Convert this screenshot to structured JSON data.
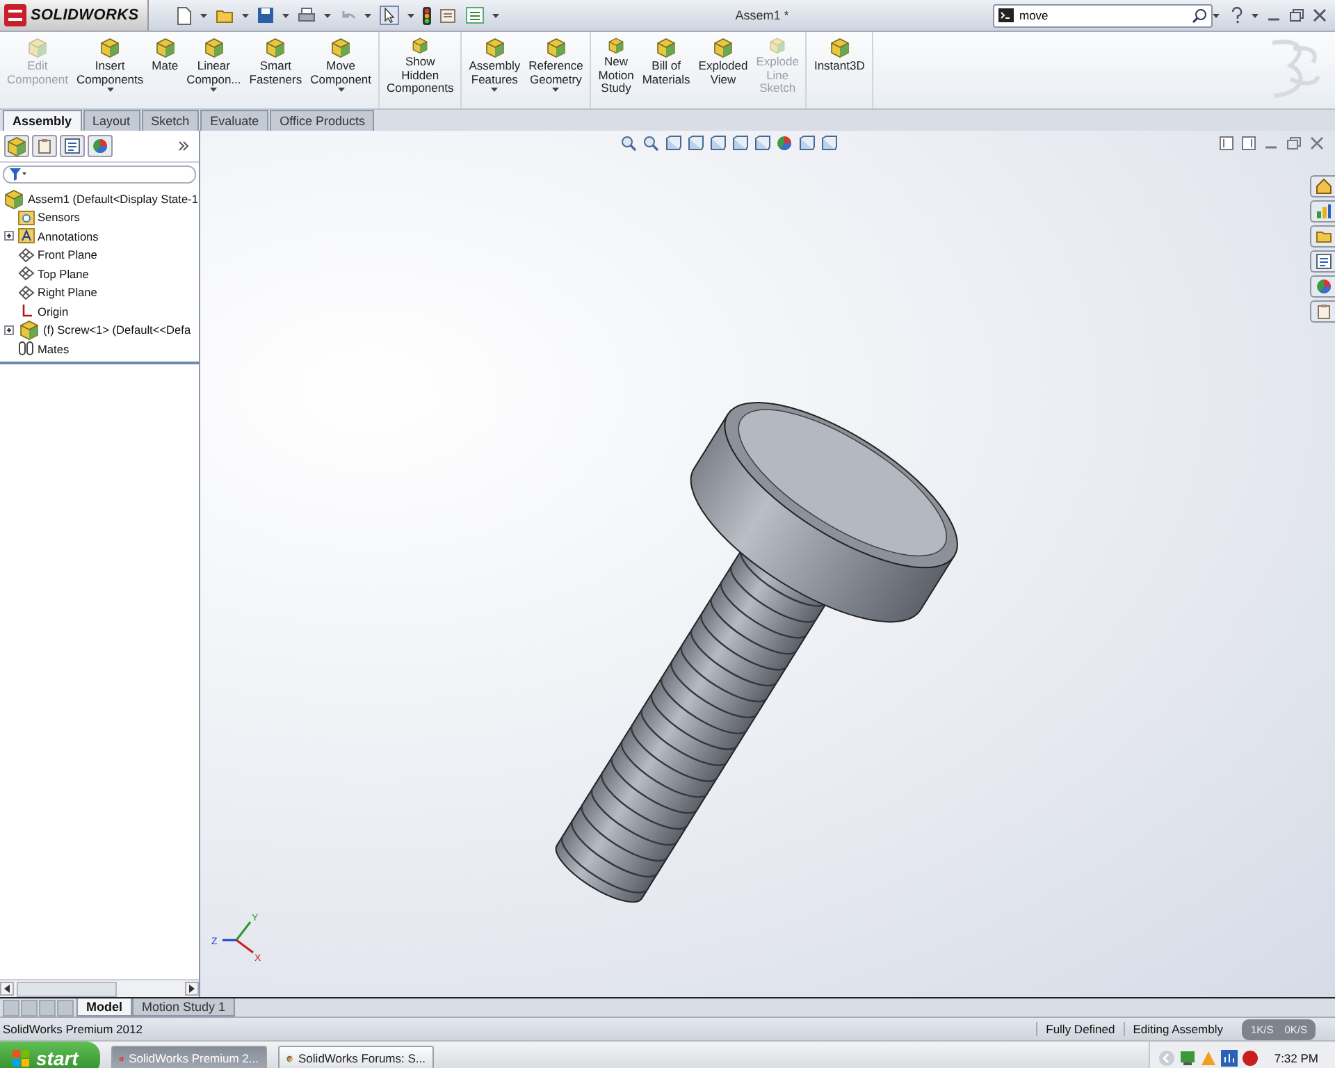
{
  "app": {
    "logo": "SOLIDWORKS",
    "title": "Assem1 *",
    "search": {
      "value": "move"
    }
  },
  "ribbon": [
    [
      {
        "label": "Edit\nComponent",
        "disabled": true,
        "dropdown": false
      },
      {
        "label": "Insert\nComponents",
        "disabled": false,
        "dropdown": true
      },
      {
        "label": "Mate",
        "disabled": false,
        "dropdown": false
      },
      {
        "label": "Linear\nCompon...",
        "disabled": false,
        "dropdown": true
      },
      {
        "label": "Smart\nFasteners",
        "disabled": false,
        "dropdown": false
      },
      {
        "label": "Move\nComponent",
        "disabled": false,
        "dropdown": true
      }
    ],
    [
      {
        "label": "Show\nHidden\nComponents",
        "disabled": false,
        "dropdown": false
      }
    ],
    [
      {
        "label": "Assembly\nFeatures",
        "disabled": false,
        "dropdown": true
      },
      {
        "label": "Reference\nGeometry",
        "disabled": false,
        "dropdown": true
      }
    ],
    [
      {
        "label": "New\nMotion\nStudy",
        "disabled": false,
        "dropdown": false
      },
      {
        "label": "Bill of\nMaterials",
        "disabled": false,
        "dropdown": false
      },
      {
        "label": "Exploded\nView",
        "disabled": false,
        "dropdown": false
      },
      {
        "label": "Explode\nLine\nSketch",
        "disabled": true,
        "dropdown": false
      }
    ],
    [
      {
        "label": "Instant3D",
        "disabled": false,
        "dropdown": false
      }
    ]
  ],
  "tabs": [
    {
      "label": "Assembly",
      "selected": true
    },
    {
      "label": "Layout",
      "selected": false
    },
    {
      "label": "Sketch",
      "selected": false
    },
    {
      "label": "Evaluate",
      "selected": false
    },
    {
      "label": "Office Products",
      "selected": false
    }
  ],
  "tree": {
    "root": "Assem1  (Default<Display State-1",
    "children": [
      {
        "label": "Sensors",
        "kind": "sensors",
        "has_children": false
      },
      {
        "label": "Annotations",
        "kind": "annotations",
        "has_children": true
      },
      {
        "label": "Front Plane",
        "kind": "plane",
        "has_children": false
      },
      {
        "label": "Top Plane",
        "kind": "plane",
        "has_children": false
      },
      {
        "label": "Right Plane",
        "kind": "plane",
        "has_children": false
      },
      {
        "label": "Origin",
        "kind": "origin",
        "has_children": false
      },
      {
        "label": "(f) Screw<1> (Default<<Defa",
        "kind": "part",
        "has_children": true
      },
      {
        "label": "Mates",
        "kind": "mates",
        "has_children": false
      }
    ]
  },
  "triad": {
    "x": "X",
    "y": "Y",
    "z": "Z"
  },
  "bottom_tabs": [
    {
      "label": "Model",
      "selected": true
    },
    {
      "label": "Motion Study 1",
      "selected": false
    }
  ],
  "status": {
    "product": "SolidWorks Premium 2012",
    "fields": [
      "Fully Defined",
      "Editing Assembly"
    ],
    "network": {
      "up": "1K/S",
      "down": "0K/S"
    }
  },
  "taskbar": {
    "start": "start",
    "tasks": [
      {
        "label": "SolidWorks Premium 2...",
        "kind": "solidworks",
        "selected": true
      },
      {
        "label": "SolidWorks Forums: S...",
        "kind": "browser",
        "selected": false
      }
    ],
    "clock": "7:32 PM"
  }
}
